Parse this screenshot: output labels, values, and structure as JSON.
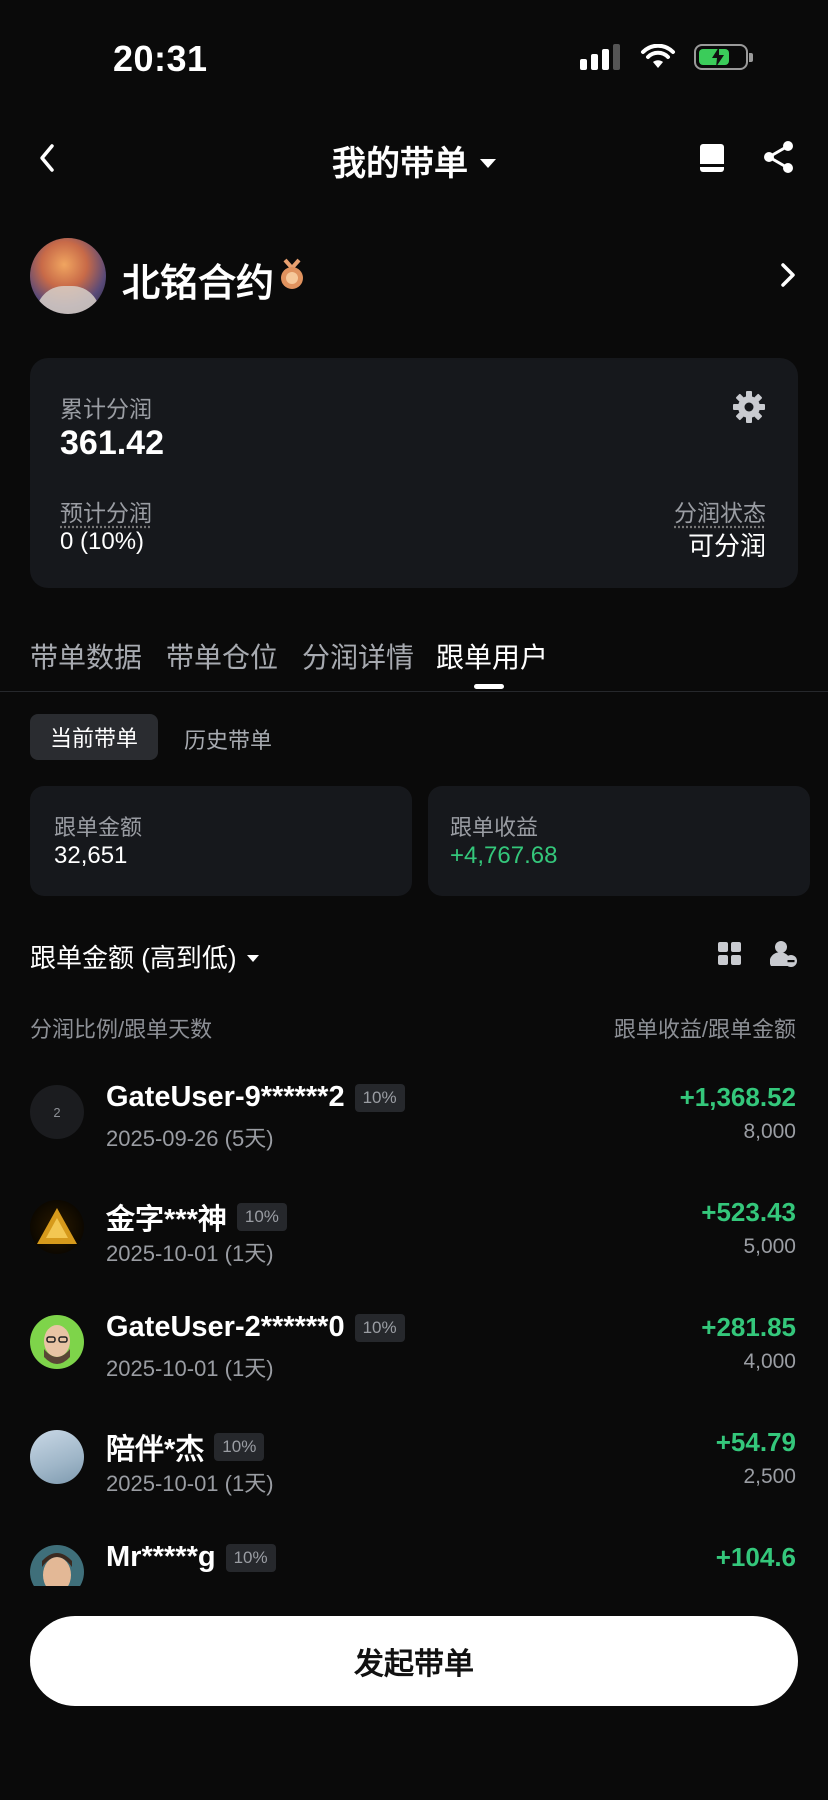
{
  "status_bar": {
    "time": "20:31"
  },
  "nav": {
    "title": "我的带单"
  },
  "profile": {
    "name": "北铭合约"
  },
  "summary_card": {
    "total_label": "累计分润",
    "total_value": "361.42",
    "estimated_label": "预计分润",
    "estimated_value": "0 (10%)",
    "status_label": "分润状态",
    "status_value": "可分润"
  },
  "tabs": [
    {
      "label": "带单数据"
    },
    {
      "label": "带单仓位"
    },
    {
      "label": "分润详情"
    },
    {
      "label": "跟单用户"
    }
  ],
  "active_tab": "跟单用户",
  "sub_tabs": [
    {
      "label": "当前带单"
    },
    {
      "label": "历史带单"
    }
  ],
  "stats": [
    {
      "label": "跟单金额",
      "value": "32,651"
    },
    {
      "label": "跟单收益",
      "value": "+4,767.68"
    }
  ],
  "sort": {
    "label": "跟单金额 (高到低)"
  },
  "columns": {
    "left": "分润比例/跟单天数",
    "right": "跟单收益/跟单金额"
  },
  "followers": [
    {
      "avatar_text": "2",
      "name": "GateUser-9******2",
      "ratio": "10%",
      "date": "2025-09-26 (5天)",
      "profit": "+1,368.52",
      "amount": "8,000"
    },
    {
      "avatar_text": "",
      "name": "金字***神",
      "ratio": "10%",
      "date": "2025-10-01 (1天)",
      "profit": "+523.43",
      "amount": "5,000"
    },
    {
      "avatar_text": "",
      "name": "GateUser-2******0",
      "ratio": "10%",
      "date": "2025-10-01 (1天)",
      "profit": "+281.85",
      "amount": "4,000"
    },
    {
      "avatar_text": "",
      "name": "陪伴*杰",
      "ratio": "10%",
      "date": "2025-10-01 (1天)",
      "profit": "+54.79",
      "amount": "2,500"
    },
    {
      "avatar_text": "",
      "name": "Mr*****g",
      "ratio": "10%",
      "date": "",
      "profit": "+104.6",
      "amount": ""
    }
  ],
  "cta": {
    "label": "发起带单"
  },
  "colors": {
    "accent_green": "#34c77b",
    "background": "#0a0a0a",
    "card": "#16181c"
  },
  "icons": [
    "signal-icon",
    "wifi-icon",
    "battery-icon",
    "back-arrow-icon",
    "caret-down-icon",
    "book-icon",
    "share-icon",
    "medal-icon",
    "chevron-right-icon",
    "gear-icon",
    "grid-icon",
    "user-remove-icon"
  ]
}
